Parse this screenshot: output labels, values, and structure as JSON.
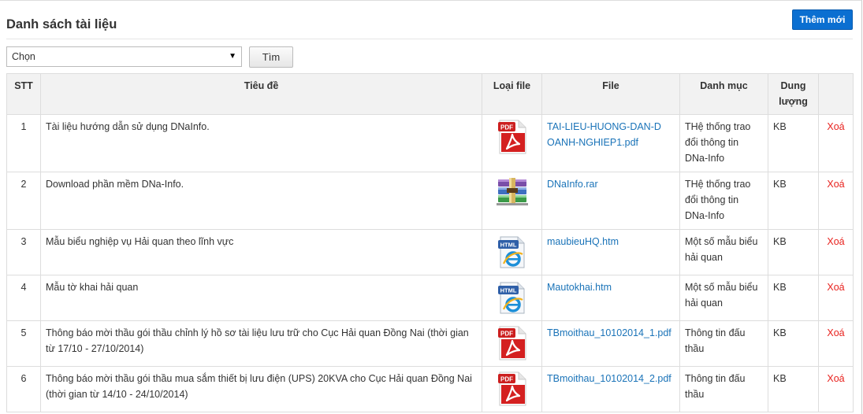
{
  "header": {
    "title": "Danh sách tài liệu",
    "add_label": "Thêm mới"
  },
  "filter": {
    "select_value": "Chọn",
    "search_label": "Tìm"
  },
  "table": {
    "columns": [
      "STT",
      "Tiêu đề",
      "Loại file",
      "File",
      "Danh mục",
      "Dung lượng",
      ""
    ],
    "rows": [
      {
        "stt": "1",
        "title": "Tài liệu hướng dẫn sử dụng DNaInfo.",
        "type_icon": "pdf-icon",
        "file": "TAI-LIEU-HUONG-DAN-DOANH-NGHIEP1.pdf",
        "category": "THệ thống trao đổi thông tin DNa-Info",
        "size": "KB",
        "action": "Xoá"
      },
      {
        "stt": "2",
        "title": "Download phần mềm DNa-Info.",
        "type_icon": "rar-archive-icon",
        "file": "DNaInfo.rar",
        "category": "THệ thống trao đổi thông tin DNa-Info",
        "size": "KB",
        "action": "Xoá"
      },
      {
        "stt": "3",
        "title": "Mẫu biểu nghiệp vụ Hải quan theo lĩnh vực",
        "type_icon": "html-file-icon",
        "file": "maubieuHQ.htm",
        "category": "Một số mẫu biểu hải quan",
        "size": "KB",
        "action": "Xoá"
      },
      {
        "stt": "4",
        "title": "Mẫu tờ khai hải quan",
        "type_icon": "html-file-icon",
        "file": "Mautokhai.htm",
        "category": "Một số mẫu biểu hải quan",
        "size": "KB",
        "action": "Xoá"
      },
      {
        "stt": "5",
        "title": "Thông báo mời thầu gói thầu chỉnh lý hồ sơ tài liệu lưu trữ cho Cục Hải quan Đồng Nai (thời gian từ 17/10 - 27/10/2014)",
        "type_icon": "pdf-icon",
        "file": "TBmoithau_10102014_1.pdf",
        "category": "Thông tin đấu thầu",
        "size": "KB",
        "action": "Xoá"
      },
      {
        "stt": "6",
        "title": "Thông báo mời thầu gói thầu mua sắm thiết bị lưu điện (UPS) 20KVA cho Cục Hải quan Đồng Nai (thời gian từ 14/10 - 24/10/2014)",
        "type_icon": "pdf-icon",
        "file": "TBmoithau_10102014_2.pdf",
        "category": "Thông tin đấu thầu",
        "size": "KB",
        "action": "Xoá"
      }
    ]
  },
  "colors": {
    "button_blue": "#0b6fd1",
    "link_blue": "#1a73b8",
    "delete_red": "#e8211d"
  }
}
